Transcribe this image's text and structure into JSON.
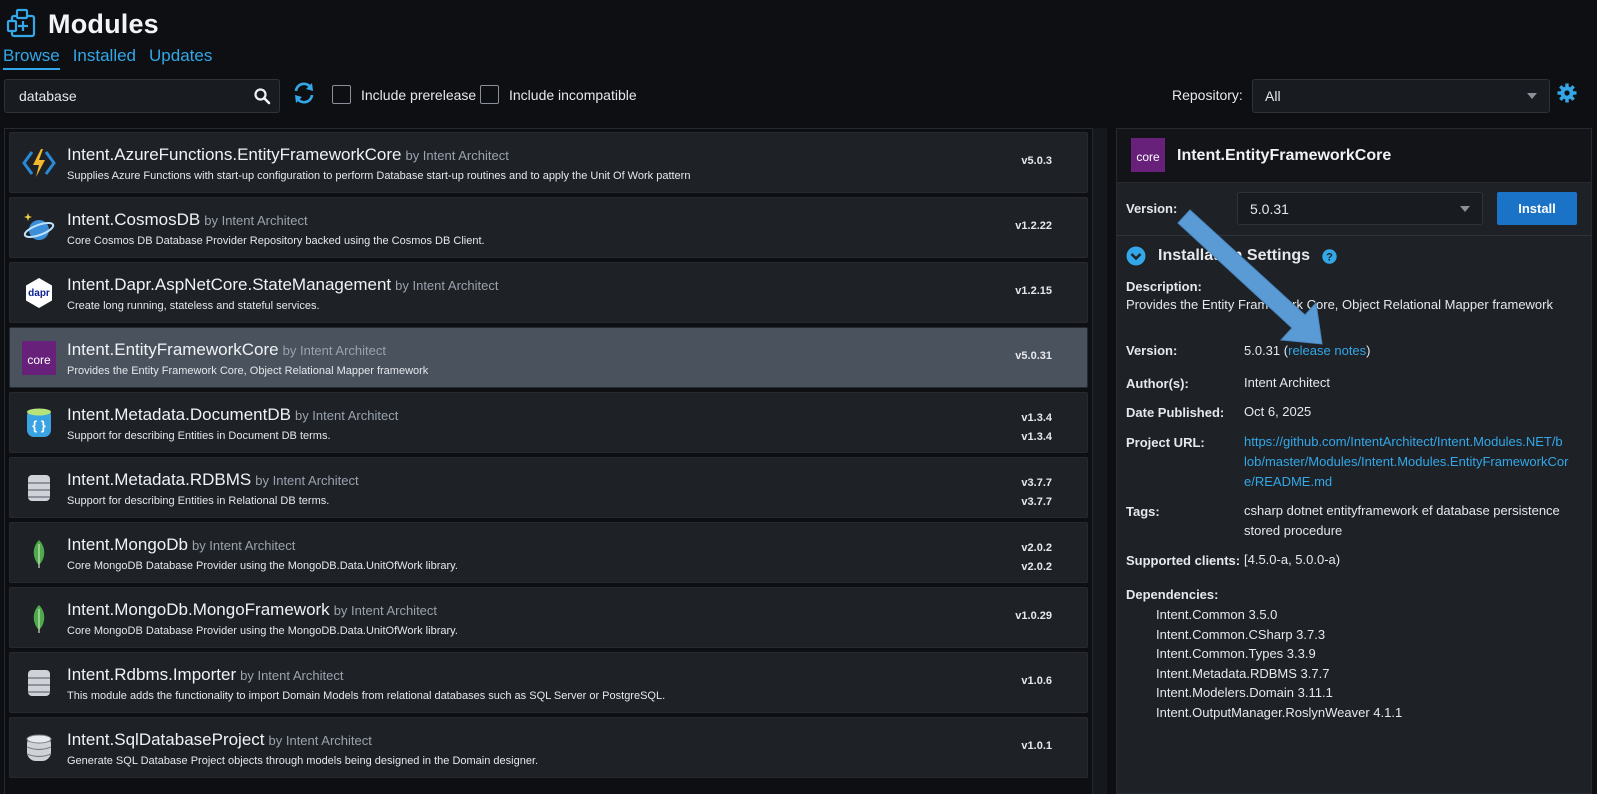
{
  "header": {
    "title": "Modules",
    "icon": "modules-plus-icon"
  },
  "tabs": [
    {
      "label": "Browse",
      "active": true
    },
    {
      "label": "Installed",
      "active": false
    },
    {
      "label": "Updates",
      "active": false
    }
  ],
  "toolbar": {
    "search_value": "database",
    "include_prerelease": "Include prerelease",
    "include_incompatible": "Include incompatible",
    "repository_label": "Repository:",
    "repository_value": "All"
  },
  "modules": [
    {
      "name": "Intent.AzureFunctions.EntityFrameworkCore",
      "by": "by Intent Architect",
      "desc": "Supplies Azure Functions with start-up configuration to perform Database start-up routines and to apply the Unit Of Work pattern",
      "version": "v5.0.3",
      "icon": "azure-functions-icon"
    },
    {
      "name": "Intent.CosmosDB",
      "by": "by Intent Architect",
      "desc": "Core Cosmos DB Database Provider Repository backed using the Cosmos DB Client.",
      "version": "v1.2.22",
      "icon": "cosmosdb-icon"
    },
    {
      "name": "Intent.Dapr.AspNetCore.StateManagement",
      "by": "by Intent Architect",
      "desc": "Create long running, stateless and stateful services.",
      "version": "v1.2.15",
      "icon": "dapr-icon"
    },
    {
      "name": "Intent.EntityFrameworkCore",
      "by": "by Intent Architect",
      "desc": "Provides the Entity Framework Core, Object Relational Mapper framework",
      "version": "v5.0.31",
      "icon": "ef-core-icon",
      "selected": true
    },
    {
      "name": "Intent.Metadata.DocumentDB",
      "by": "by Intent Architect",
      "desc": "Support for describing Entities in Document DB terms.",
      "version": "v1.3.4",
      "version2": "v1.3.4",
      "icon": "document-db-icon"
    },
    {
      "name": "Intent.Metadata.RDBMS",
      "by": "by Intent Architect",
      "desc": "Support for describing Entities in Relational DB terms.",
      "version": "v3.7.7",
      "version2": "v3.7.7",
      "icon": "database-icon"
    },
    {
      "name": "Intent.MongoDb",
      "by": "by Intent Architect",
      "desc": "Core MongoDB Database Provider using the MongoDB.Data.UnitOfWork library.",
      "version": "v2.0.2",
      "version2": "v2.0.2",
      "icon": "mongodb-leaf-icon"
    },
    {
      "name": "Intent.MongoDb.MongoFramework",
      "by": "by Intent Architect",
      "desc": "Core MongoDB Database Provider using the MongoDB.Data.UnitOfWork library.",
      "version": "v1.0.29",
      "icon": "mongodb-leaf-icon"
    },
    {
      "name": "Intent.Rdbms.Importer",
      "by": "by Intent Architect",
      "desc": "This module adds the functionality to import Domain Models from relational databases such as SQL Server or PostgreSQL.",
      "version": "v1.0.6",
      "icon": "database-icon"
    },
    {
      "name": "Intent.SqlDatabaseProject",
      "by": "by Intent Architect",
      "desc": "Generate SQL Database Project objects through models being designed in the Domain designer.",
      "version": "v1.0.1",
      "icon": "sql-database-icon"
    }
  ],
  "detail": {
    "title": "Intent.EntityFrameworkCore",
    "version_label": "Version:",
    "version_value": "5.0.31",
    "install_label": "Install",
    "settings_label": "Installation Settings",
    "description_label": "Description:",
    "description": "Provides the Entity Framework Core, Object Relational Mapper framework",
    "version_row_label": "Version:",
    "version_row_value": "5.0.31",
    "release_notes": "release notes",
    "authors_label": "Author(s):",
    "authors": "Intent Architect",
    "date_label": "Date Published:",
    "date": "Oct 6, 2025",
    "url_label": "Project URL:",
    "url_lines": [
      "https://github.com/IntentArchitect/Intent.Modules.NET/b",
      "lob/master/Modules/Intent.Modules.EntityFrameworkCor",
      "e/README.md"
    ],
    "tags_label": "Tags:",
    "tags_lines": [
      "csharp dotnet entityframework ef database persistence",
      "stored procedure"
    ],
    "clients_label": "Supported clients:",
    "clients": "[4.5.0-a, 5.0.0-a)",
    "deps_label": "Dependencies:",
    "dependencies": [
      "Intent.Common 3.5.0",
      "Intent.Common.CSharp 3.7.3",
      "Intent.Common.Types 3.3.9",
      "Intent.Metadata.RDBMS 3.7.7",
      "Intent.Modelers.Domain 3.11.1",
      "Intent.OutputManager.RoslynWeaver 4.1.1"
    ]
  },
  "colors": {
    "accent": "#33a7e8",
    "install": "#1a73c6",
    "selected_row": "#4a525e",
    "annotation_arrow": "#5b9bd5"
  }
}
